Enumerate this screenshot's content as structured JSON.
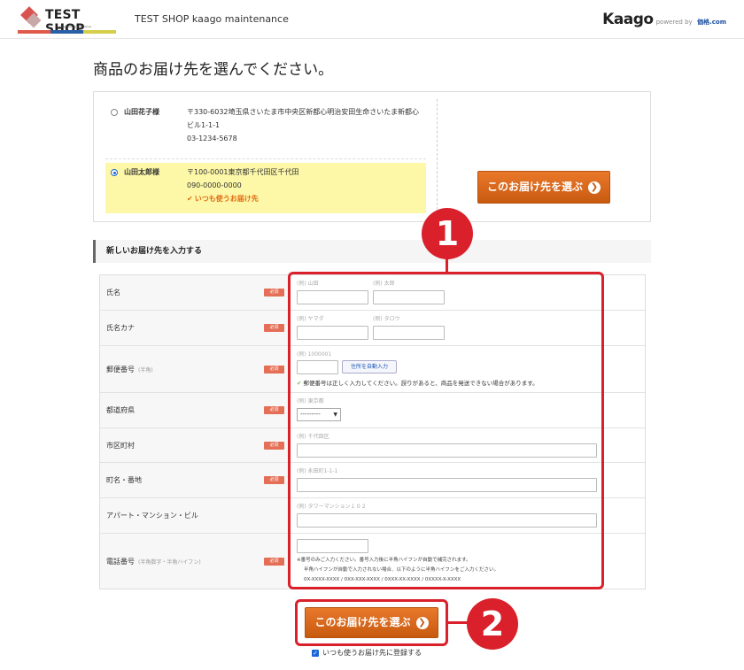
{
  "header": {
    "logo_text": "TEST SHOP",
    "logo_sub": "kaago site maintenance",
    "title": "TEST SHOP kaago maintenance",
    "brand": "Kaago",
    "powered_by": "powered by",
    "powered_brand": "価格.com"
  },
  "page_title": "商品のお届け先を選んでください。",
  "saved_addresses": [
    {
      "name": "山田花子様",
      "address_line1": "〒330-6032埼玉県さいたま市中央区新都心明治安田生命さいたま新都心",
      "address_line2": "ビル1-1-1",
      "phone": "03-1234-5678",
      "selected": false,
      "default_label": ""
    },
    {
      "name": "山田太郎様",
      "address_line1": "〒100-0001東京都千代田区千代田",
      "address_line2": "",
      "phone": "090-0000-0000",
      "selected": true,
      "default_label": "いつも使うお届け先"
    }
  ],
  "select_button_label": "このお届け先を選ぶ",
  "new_address": {
    "section_title": "新しいお届け先を入力する",
    "required_label": "必須",
    "fields": {
      "name": {
        "label": "氏名",
        "ph_last": "(例) 山田",
        "ph_first": "(例) 太郎"
      },
      "kana": {
        "label": "氏名カナ",
        "ph_last": "(例) ヤマダ",
        "ph_first": "(例) タロウ"
      },
      "postal": {
        "label": "郵便番号",
        "sub": "(半角)",
        "ph": "(例) 1000001",
        "auto_button": "住所を自動入力",
        "note": "郵便番号は正しく入力してください。誤りがあると、商品を発送できない場合があります。"
      },
      "prefecture": {
        "label": "都道府県",
        "ph": "(例) 東京都",
        "value": "---------"
      },
      "city": {
        "label": "市区町村",
        "ph": "(例) 千代田区"
      },
      "street": {
        "label": "町名・番地",
        "ph": "(例) 永田町1-1-1"
      },
      "building": {
        "label": "アパート・マンション・ビル",
        "ph": "(例) タワーマンション１０２"
      },
      "phone": {
        "label": "電話番号",
        "sub": "(半角数字・半角ハイフン)",
        "note1": "※番号のみご入力ください。番号入力後に半角ハイフンが自動で補完されます。",
        "note2": "半角ハイフンが自動で入力されない場合、以下のように半角ハイフンをご入力ください。",
        "note3": "0X-XXXX-XXXX / 0XX-XXX-XXXX / 0XXX-XX-XXXX / 0XXXX-X-XXXX"
      }
    }
  },
  "remember_label": "いつも使うお届け先に登録する",
  "callouts": {
    "one": "1",
    "two": "2"
  },
  "colors": {
    "accent": "#d9202b",
    "button": "#d8691a",
    "highlight": "#fdf8a8"
  }
}
